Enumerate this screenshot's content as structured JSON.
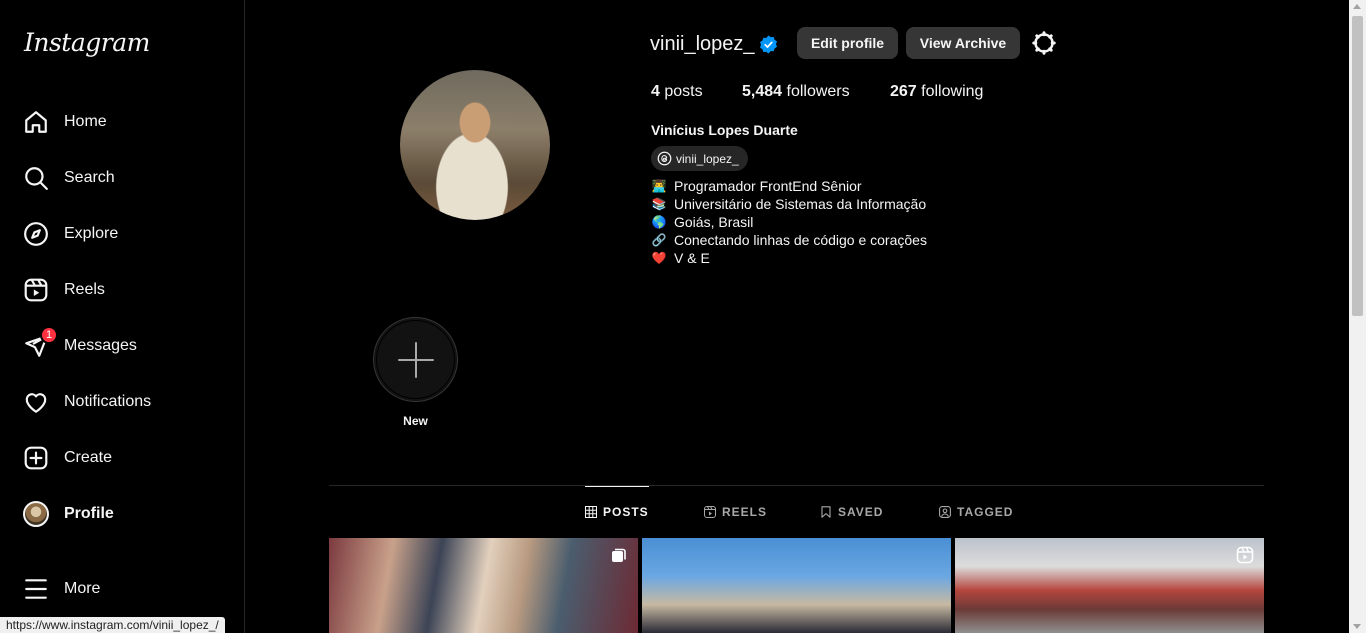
{
  "sidebar": {
    "logo": "Instagram",
    "items": [
      {
        "label": "Home",
        "icon": "home-icon"
      },
      {
        "label": "Search",
        "icon": "search-icon"
      },
      {
        "label": "Explore",
        "icon": "compass-icon"
      },
      {
        "label": "Reels",
        "icon": "reels-icon"
      },
      {
        "label": "Messages",
        "icon": "messenger-icon",
        "badge": "1"
      },
      {
        "label": "Notifications",
        "icon": "heart-icon"
      },
      {
        "label": "Create",
        "icon": "plus-square-icon"
      },
      {
        "label": "Profile",
        "icon": "avatar",
        "active": true
      },
      {
        "label": "More",
        "icon": "menu-icon"
      }
    ]
  },
  "profile": {
    "username": "vinii_lopez_",
    "verified": true,
    "edit_label": "Edit profile",
    "archive_label": "View Archive",
    "posts_count": "4",
    "posts_label": "posts",
    "followers_count": "5,484",
    "followers_label": "followers",
    "following_count": "267",
    "following_label": "following",
    "full_name": "Vinícius Lopes Duarte",
    "threads_handle": "vinii_lopez_",
    "bio": [
      {
        "emoji": "👨‍💻",
        "text": "Programador FrontEnd Sênior"
      },
      {
        "emoji": "📚",
        "text": "Universitário de Sistemas da Informação"
      },
      {
        "emoji": "🌎",
        "text": "Goiás, Brasil"
      },
      {
        "emoji": "🔗",
        "text": "Conectando linhas de código e corações"
      },
      {
        "emoji": "❤️",
        "text": "V & E"
      }
    ]
  },
  "highlights": {
    "new_label": "New"
  },
  "tabs": [
    {
      "label": "POSTS",
      "active": true
    },
    {
      "label": "REELS"
    },
    {
      "label": "SAVED"
    },
    {
      "label": "TAGGED"
    }
  ],
  "posts": [
    {
      "type": "carousel"
    },
    {
      "type": "image"
    },
    {
      "type": "reel"
    }
  ],
  "status_bar": {
    "url": "https://www.instagram.com/vinii_lopez_/"
  },
  "colors": {
    "background": "#000000",
    "button": "#363636",
    "verified": "#0095f6",
    "badge": "#ff3040",
    "divider": "#262626"
  }
}
